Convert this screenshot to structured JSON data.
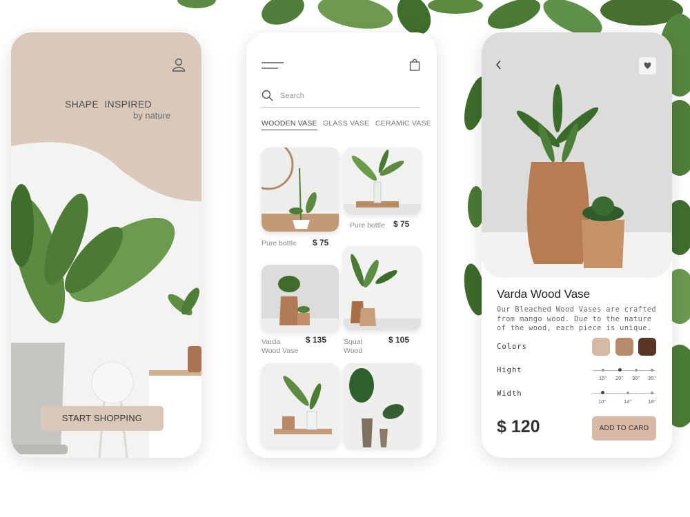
{
  "screen1": {
    "brand_title": "SHAPE  INSPIRED",
    "brand_subtitle": "by nature",
    "start_button": "START SHOPPING",
    "colors": {
      "beige": "#dac9bb"
    }
  },
  "screen2": {
    "search_placeholder": "Search",
    "tabs": [
      {
        "label": "WOODEN VASE",
        "active": true
      },
      {
        "label": "GLASS VASE",
        "active": false
      },
      {
        "label": "CERAMIC VASE",
        "active": false
      }
    ],
    "products": [
      {
        "name": "Pure bottle",
        "price": "$ 75"
      },
      {
        "name": "Pure bottle",
        "price": "$ 75"
      },
      {
        "name": "Varda\nWood Vase",
        "price": "$ 135"
      },
      {
        "name": "Squat\nWood",
        "price": "$ 105"
      },
      {
        "name": "",
        "price": ""
      },
      {
        "name": "",
        "price": ""
      }
    ]
  },
  "screen3": {
    "title": "Varda Wood Vase",
    "description": "Our Bleached Wood Vases are crafted from mango wood. Due to the nature of the wood, each piece is unique.",
    "colors_label": "Colors",
    "swatches": [
      "#d6b9a3",
      "#b78b6b",
      "#5a3526"
    ],
    "height_label": "Hight",
    "height_ticks": [
      "15\"",
      "20\"",
      "30\"",
      "35\""
    ],
    "width_label": "Width",
    "width_ticks": [
      "10\"",
      "14\"",
      "18\""
    ],
    "price": "$ 120",
    "add_button": "ADD TO CARD"
  }
}
